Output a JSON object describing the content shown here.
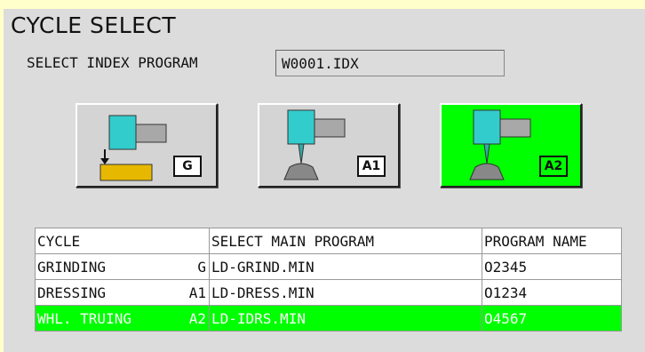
{
  "title": "CYCLE SELECT",
  "index_program": {
    "label": "SELECT INDEX PROGRAM",
    "value": "W0001.IDX"
  },
  "cycle_buttons": [
    {
      "tag": "G",
      "icon": "grinding-icon",
      "active": false
    },
    {
      "tag": "A1",
      "icon": "dressing-icon",
      "active": false
    },
    {
      "tag": "A2",
      "icon": "truing-icon",
      "active": true
    }
  ],
  "table": {
    "headers": [
      "CYCLE",
      "SELECT MAIN PROGRAM",
      "PROGRAM NAME"
    ],
    "rows": [
      {
        "cycle": "GRINDING",
        "code": "G",
        "main_program": "LD-GRIND.MIN",
        "program_name": "O2345",
        "selected": false
      },
      {
        "cycle": "DRESSING",
        "code": "A1",
        "main_program": "LD-DRESS.MIN",
        "program_name": "O1234",
        "selected": false
      },
      {
        "cycle": "WHL. TRUING",
        "code": "A2",
        "main_program": "LD-IDRS.MIN",
        "program_name": "O4567",
        "selected": true
      }
    ]
  },
  "colors": {
    "active": "#00ff00",
    "panel": "#dcdcdc",
    "outer": "#ffffcc",
    "spindle_cyan": "#33cccc",
    "workpiece_gold": "#e6b800"
  }
}
